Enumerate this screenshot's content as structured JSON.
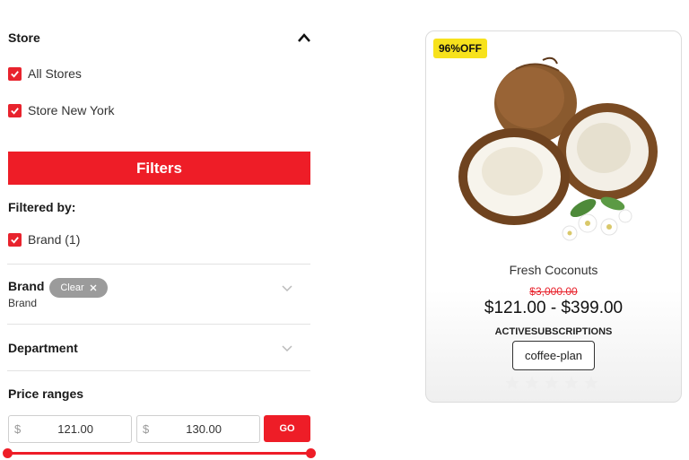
{
  "store_filter": {
    "title": "Store",
    "options": [
      {
        "label": "All Stores",
        "checked": true
      },
      {
        "label": "Store New York",
        "checked": true
      }
    ]
  },
  "filters_button": "Filters",
  "filtered_by": {
    "title": "Filtered by:",
    "items": [
      {
        "label": "Brand (1)",
        "checked": true
      }
    ]
  },
  "brand_filter": {
    "title": "Brand",
    "clear_label": "Clear",
    "subtitle": "Brand"
  },
  "department_filter": {
    "title": "Department"
  },
  "price_ranges": {
    "title": "Price ranges",
    "currency": "$",
    "min_value": "121.00",
    "max_value": "130.00",
    "go_label": "GO"
  },
  "product": {
    "badge": "96%OFF",
    "name": "Fresh Coconuts",
    "old_price": "$3,000.00",
    "price_range": "$121.00 - $399.00",
    "subscription_label": "ACTIVESUBSCRIPTIONS",
    "plan_button": "coffee-plan",
    "rating": 0,
    "rating_max": 5
  },
  "colors": {
    "accent": "#ee1d27",
    "badge": "#f7e21c",
    "clear_pill": "#9b9b9b"
  },
  "icons": [
    "chevron-up-icon",
    "chevron-down-icon",
    "check-icon",
    "close-icon",
    "star-icon"
  ]
}
